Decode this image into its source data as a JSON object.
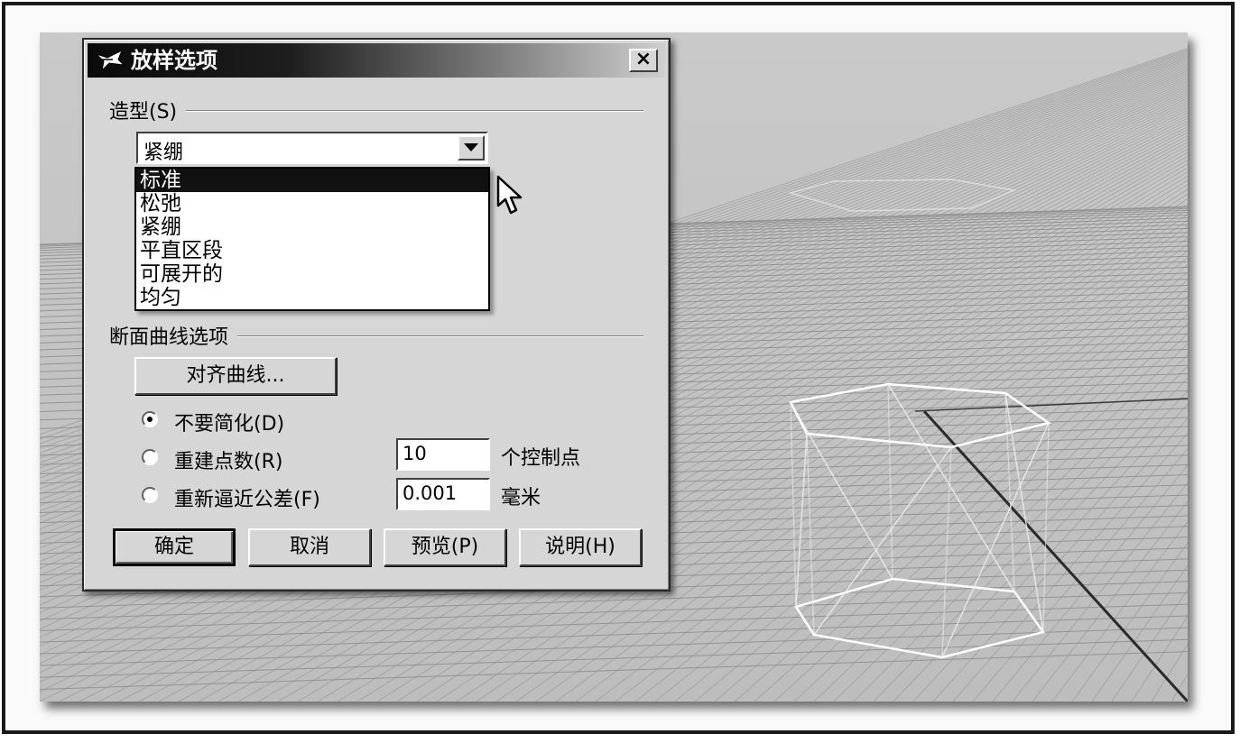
{
  "dialog": {
    "title": "放样选项",
    "close_label": "×",
    "shape_group": {
      "label": "造型(S)"
    },
    "shape_combo": {
      "value": "紧绷",
      "options": [
        "标准",
        "松弛",
        "紧绷",
        "平直区段",
        "可展开的",
        "均匀"
      ],
      "highlighted": "标准"
    },
    "section_group": {
      "label": "断面曲线选项"
    },
    "align_button": "对齐曲线...",
    "radios": [
      {
        "label": "不要简化(D)",
        "checked": true
      },
      {
        "label": "重建点数(R)",
        "checked": false,
        "value": "10",
        "unit": "个控制点"
      },
      {
        "label": "重新逼近公差(F)",
        "checked": false,
        "value": "0.001",
        "unit": "毫米"
      }
    ],
    "buttons": {
      "ok": "确定",
      "cancel": "取消",
      "preview": "预览(P)",
      "help": "说明(H)"
    }
  },
  "viewport": {
    "background": "#c4c4c4",
    "grid_color": "#8f8f8f",
    "wire_color": "#ffffff"
  }
}
